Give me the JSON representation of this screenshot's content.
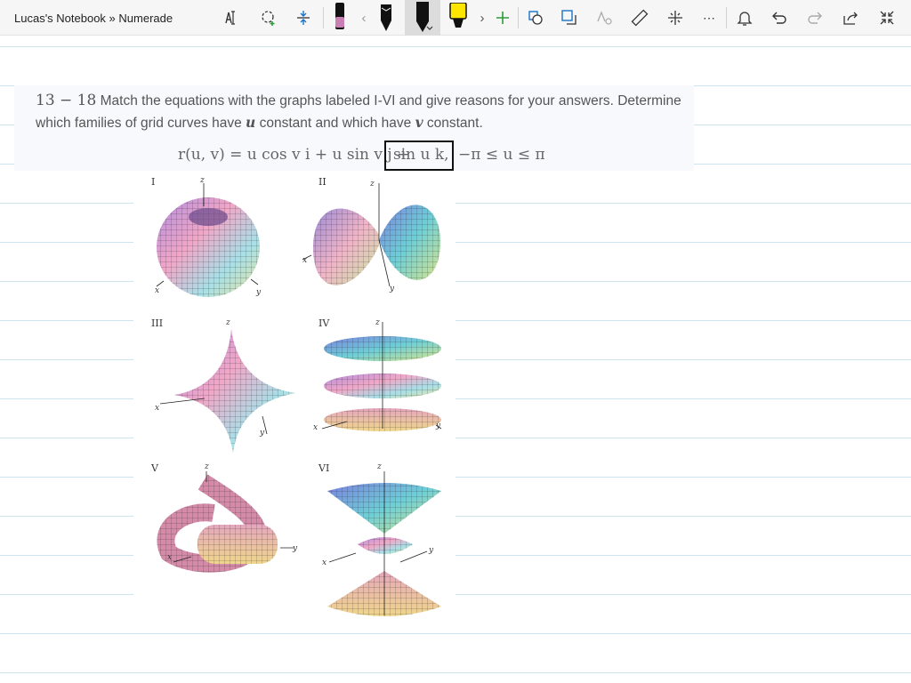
{
  "window": {
    "title": "Lucas's Notebook » Numerade"
  },
  "toolbar": {
    "icons": [
      "lasso-text-icon",
      "lasso-select-icon",
      "add-space-icon",
      "pen-pink-icon",
      "chevron-left-icon",
      "pen-black-icon",
      "pen-black-selected-icon",
      "highlighter-yellow-icon",
      "chevron-right-icon",
      "add-pen-icon",
      "shapes-icon",
      "convert-icon",
      "math-icon",
      "ruler-icon",
      "format-icon",
      "more-icon",
      "bell-icon",
      "undo-icon",
      "redo-icon",
      "share-icon",
      "collapse-icon"
    ],
    "colors": {
      "pink_pen": "#c97fb3",
      "black_pen": "#111111",
      "yellow_highlighter": "#ffe600",
      "add_green": "#2e9b3a"
    }
  },
  "problem": {
    "number": "13 − 18",
    "text_a": "Match the equations with the graphs labeled I-VI and give reasons for your answers. Determine which families of grid curves have ",
    "var_u": "u",
    "text_b": " constant and which have ",
    "var_v": "v",
    "text_c": " constant.",
    "equation_left": "r(u, v) = u cos v i + u sin v j + ",
    "equation_boxed": "sin u k,",
    "equation_right": "−π ≤ u ≤ π"
  },
  "figures": [
    {
      "label": "I",
      "axes": [
        "z",
        "x",
        "y"
      ]
    },
    {
      "label": "II",
      "axes": [
        "z",
        "x",
        "y"
      ]
    },
    {
      "label": "III",
      "axes": [
        "z",
        "x",
        "y"
      ]
    },
    {
      "label": "IV",
      "axes": [
        "z",
        "x",
        "y"
      ]
    },
    {
      "label": "V",
      "axes": [
        "z",
        "x",
        "y"
      ]
    },
    {
      "label": "VI",
      "axes": [
        "z",
        "x",
        "y"
      ]
    }
  ],
  "ink": {
    "box_color": "#111111"
  }
}
